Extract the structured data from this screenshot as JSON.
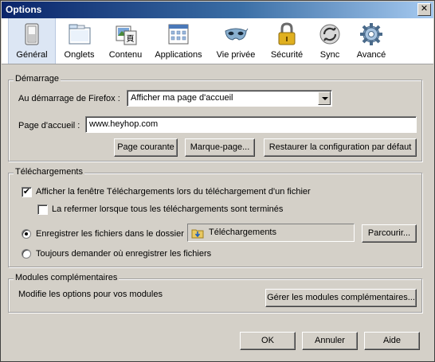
{
  "window": {
    "title": "Options",
    "close_label": "✕"
  },
  "toolbar": {
    "tabs": [
      {
        "label": "Général",
        "icon": "general-icon",
        "selected": true
      },
      {
        "label": "Onglets",
        "icon": "tabs-icon"
      },
      {
        "label": "Contenu",
        "icon": "content-icon"
      },
      {
        "label": "Applications",
        "icon": "applications-icon"
      },
      {
        "label": "Vie privée",
        "icon": "privacy-mask-icon"
      },
      {
        "label": "Sécurité",
        "icon": "padlock-icon"
      },
      {
        "label": "Sync",
        "icon": "sync-icon"
      },
      {
        "label": "Avancé",
        "icon": "gear-icon"
      }
    ]
  },
  "startup": {
    "legend": "Démarrage",
    "startup_label": "Au démarrage de Firefox :",
    "startup_value": "Afficher ma page d'accueil",
    "homepage_label": "Page d'accueil :",
    "homepage_value": "www.heyhop.com",
    "btn_current": "Page courante",
    "btn_bookmark": "Marque-page...",
    "btn_restore": "Restaurer la configuration par défaut"
  },
  "downloads": {
    "legend": "Téléchargements",
    "show_window_label": "Afficher la fenêtre Téléchargements lors du téléchargement d'un fichier",
    "show_window_checked": true,
    "close_when_done_label": "La refermer lorsque tous les téléchargements sont terminés",
    "close_when_done_checked": false,
    "save_to_label": "Enregistrer les fichiers dans le dossier",
    "save_to_selected": true,
    "folder_name": "Téléchargements",
    "browse_button": "Parcourir...",
    "ask_label": "Toujours demander où enregistrer les fichiers",
    "ask_selected": false
  },
  "addons": {
    "legend": "Modules complémentaires",
    "description": "Modifie les options pour vos modules",
    "manage_button": "Gérer les modules complémentaires..."
  },
  "footer": {
    "ok": "OK",
    "cancel": "Annuler",
    "help": "Aide"
  }
}
